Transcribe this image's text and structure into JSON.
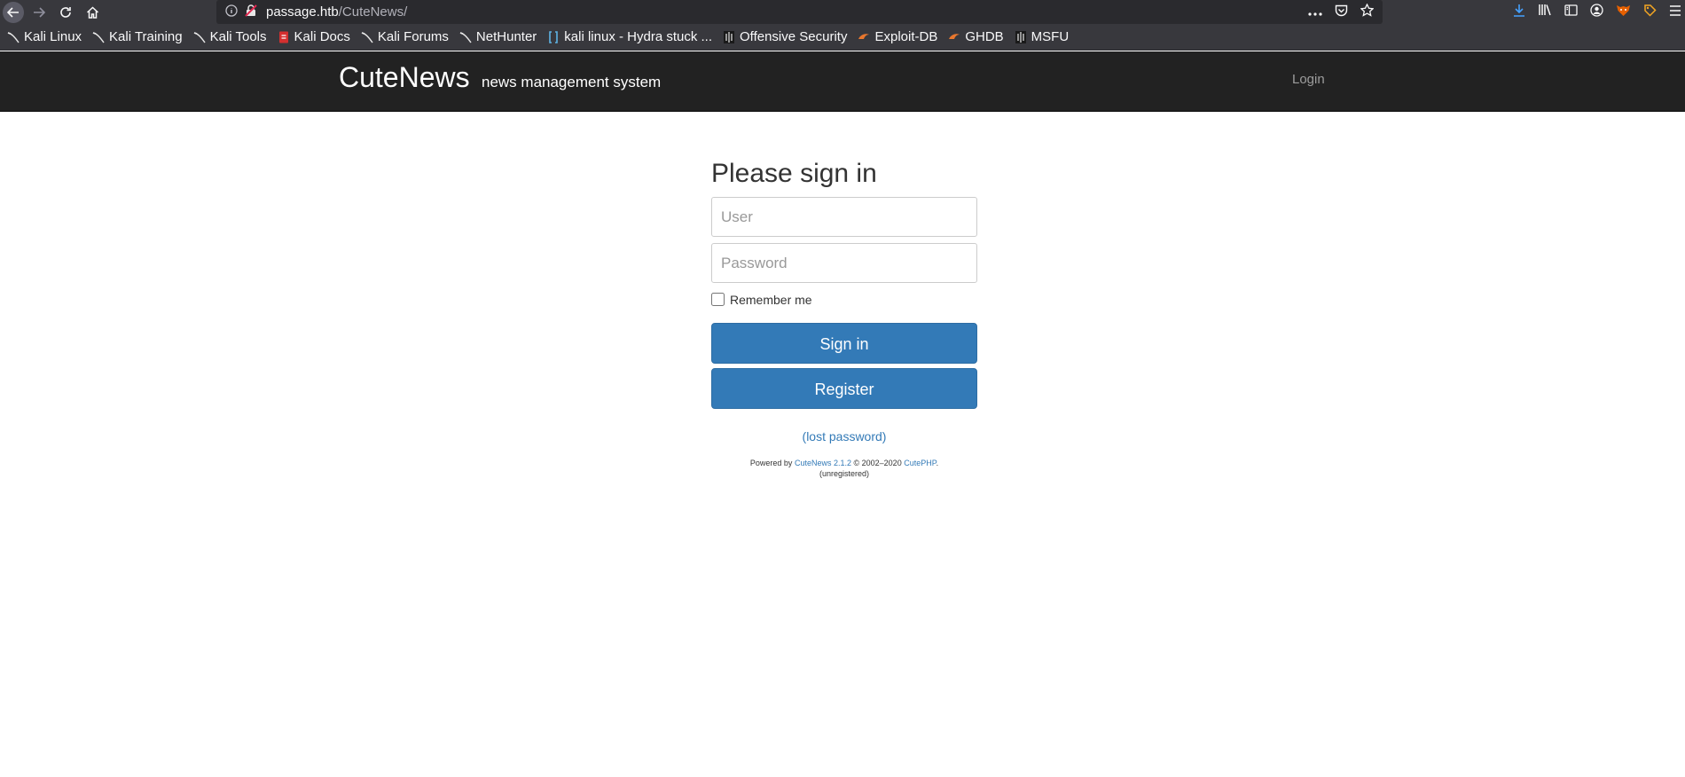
{
  "browser": {
    "url_host": "passage.htb",
    "url_path": "/CuteNews/",
    "bookmarks": [
      "Kali Linux",
      "Kali Training",
      "Kali Tools",
      "Kali Docs",
      "Kali Forums",
      "NetHunter",
      "kali linux - Hydra stuck ...",
      "Offensive Security",
      "Exploit-DB",
      "GHDB",
      "MSFU"
    ]
  },
  "navbar": {
    "brand": "CuteNews",
    "tagline": "news management system",
    "login": "Login"
  },
  "form": {
    "title": "Please sign in",
    "user_placeholder": "User",
    "password_placeholder": "Password",
    "remember_label": "Remember me",
    "signin_label": "Sign in",
    "register_label": "Register",
    "lost_password": "(lost password)"
  },
  "footer": {
    "powered_by": "Powered by",
    "product_link": "CuteNews 2.1.2",
    "copyright": "© 2002–2020",
    "vendor_link": "CutePHP",
    "period": ".",
    "status": "(unregistered)"
  },
  "colors": {
    "chrome": "#38383d",
    "navbar": "#222222",
    "primary": "#337ab7"
  }
}
